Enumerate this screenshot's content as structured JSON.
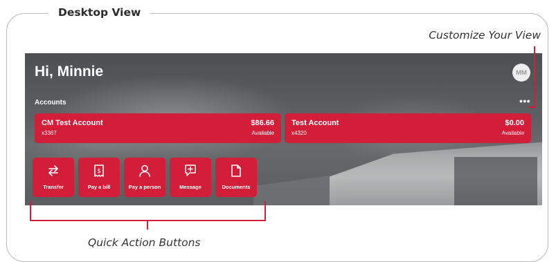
{
  "frame": {
    "title": "Desktop View"
  },
  "callouts": {
    "customize": "Customize Your View",
    "quick_actions": "Quick Action Buttons"
  },
  "dashboard": {
    "greeting": "Hi, Minnie",
    "avatar_initials": "MM",
    "accounts_label": "Accounts",
    "more_menu": "•••",
    "accounts": [
      {
        "name": "CM Test Account",
        "number": "x3367",
        "balance": "$86.66",
        "balance_label": "Available"
      },
      {
        "name": "Test Account",
        "number": "x4320",
        "balance": "$0.00",
        "balance_label": "Available"
      }
    ],
    "quick_actions": [
      {
        "label": "Transfer",
        "icon": "transfer-icon"
      },
      {
        "label": "Pay a bill",
        "icon": "bill-icon"
      },
      {
        "label": "Pay a person",
        "icon": "person-icon"
      },
      {
        "label": "Message",
        "icon": "message-icon"
      },
      {
        "label": "Documents",
        "icon": "document-icon"
      }
    ]
  },
  "colors": {
    "accent": "#D31E3A",
    "frame_border": "#B9B9B9",
    "text": "#2C2C2C"
  }
}
